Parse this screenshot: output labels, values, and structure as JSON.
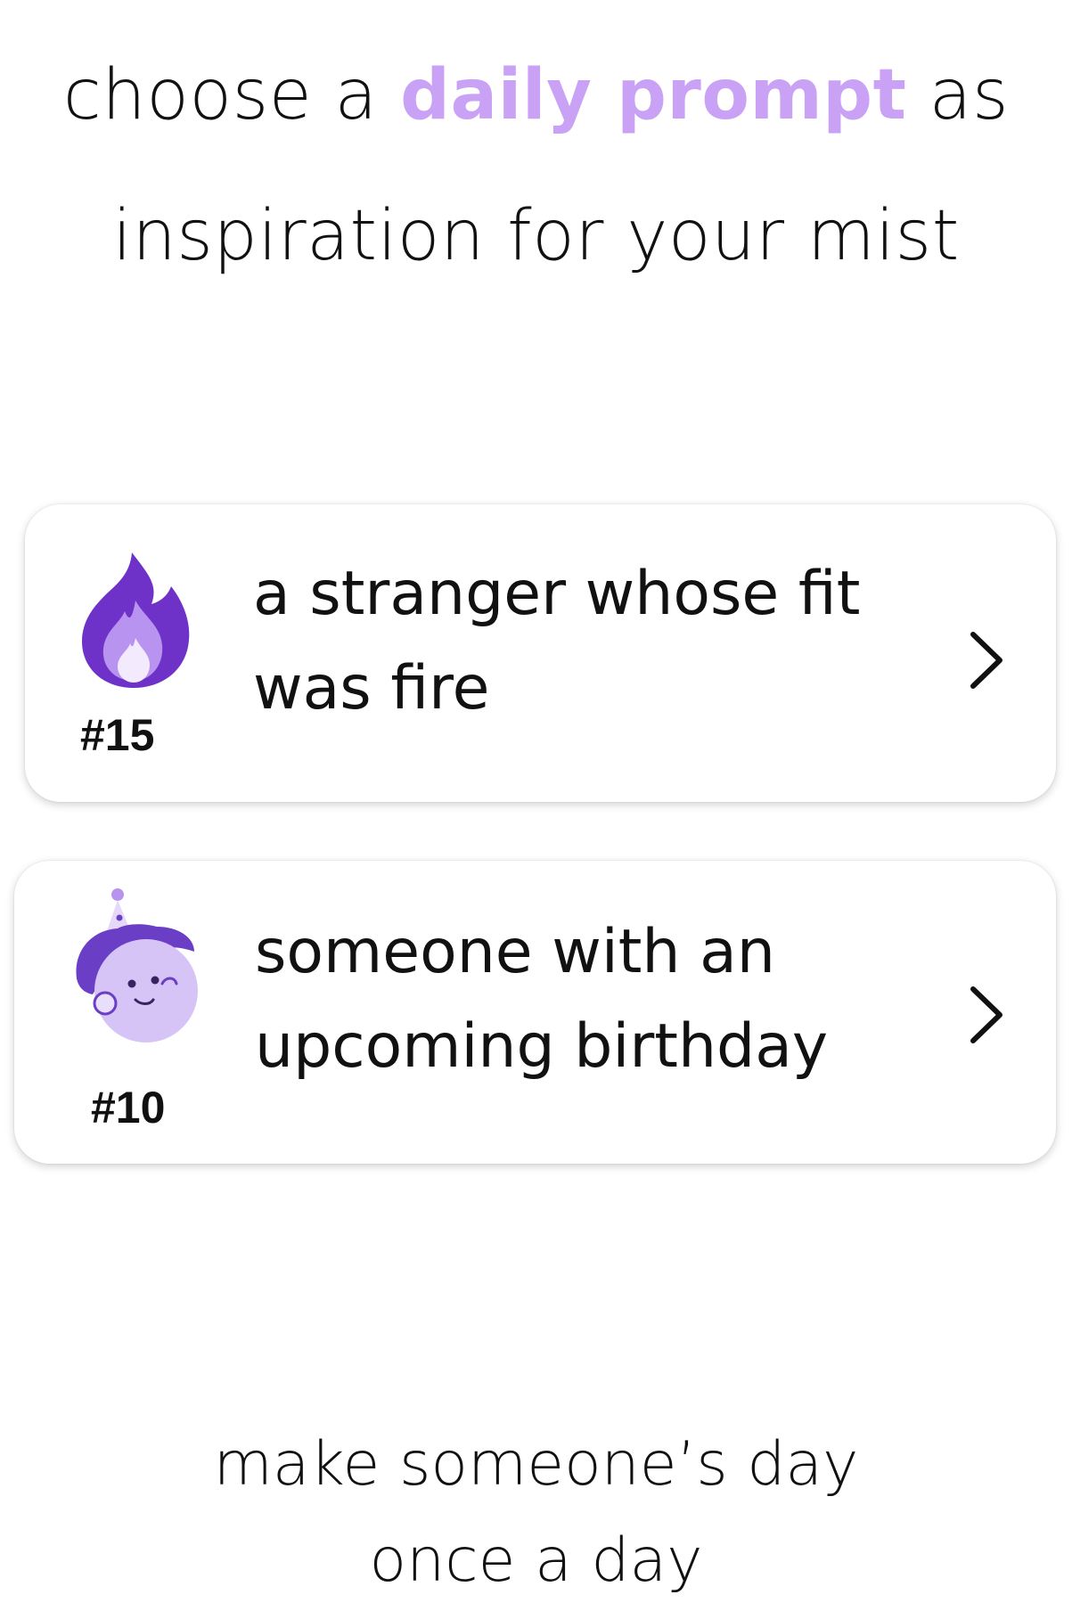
{
  "headline": {
    "before": "choose a ",
    "highlight": "daily prompt",
    "after": " as",
    "line2": "inspiration for your mist"
  },
  "prompts": [
    {
      "number": "#15",
      "icon": "purple-flame-icon",
      "line1": "a stranger whose fit",
      "line2": "was fire"
    },
    {
      "number": "#10",
      "icon": "birthday-face-icon",
      "line1": "someone with an",
      "line2": "upcoming birthday"
    }
  ],
  "footer": {
    "line1": "make someone’s day",
    "line2": "once a day"
  },
  "colors": {
    "accent": "#c9a2f6",
    "flame_dark": "#6f32c9",
    "flame_light": "#b894f0",
    "face": "#d7c4f7",
    "hair": "#6a3ec5"
  }
}
